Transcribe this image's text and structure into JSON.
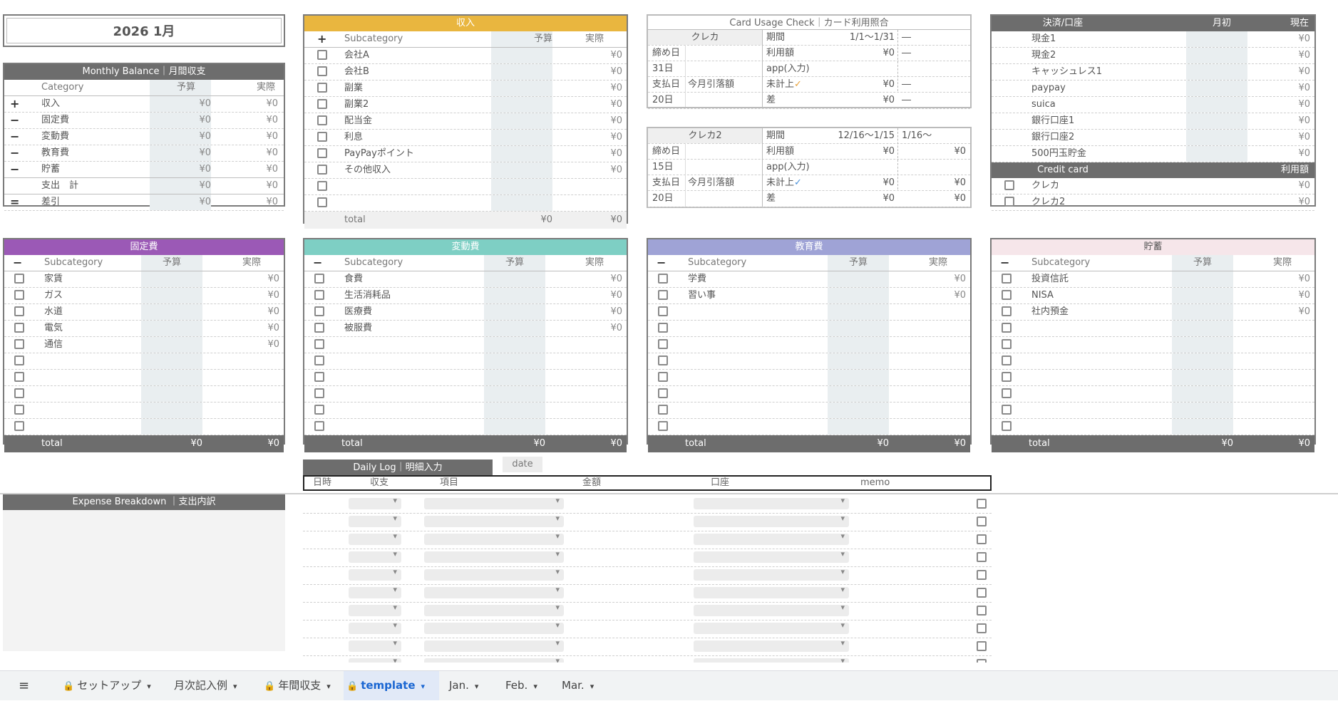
{
  "title": "2026  1月",
  "monthly": {
    "header": "Monthly Balance｜月間収支",
    "col_category": "Category",
    "col_budget": "予算",
    "col_actual": "実際",
    "rows": [
      {
        "sym": "+",
        "label": "収入",
        "budget": "¥0",
        "actual": "¥0"
      },
      {
        "sym": "−",
        "label": "固定費",
        "budget": "¥0",
        "actual": "¥0"
      },
      {
        "sym": "−",
        "label": "変動費",
        "budget": "¥0",
        "actual": "¥0"
      },
      {
        "sym": "−",
        "label": "教育費",
        "budget": "¥0",
        "actual": "¥0"
      },
      {
        "sym": "−",
        "label": "貯蓄",
        "budget": "¥0",
        "actual": "¥0"
      },
      {
        "sym": "",
        "label": "支出　計",
        "budget": "¥0",
        "actual": "¥0"
      },
      {
        "sym": "=",
        "label": "差引",
        "budget": "¥0",
        "actual": "¥0"
      }
    ]
  },
  "income": {
    "header": "収入",
    "color": "#e9b63f",
    "sym": "+",
    "col_sub": "Subcategory",
    "col_budget": "予算",
    "col_actual": "実際",
    "rows": [
      {
        "label": "会社A",
        "actual": "¥0"
      },
      {
        "label": "会社B",
        "actual": "¥0"
      },
      {
        "label": "副業",
        "actual": "¥0"
      },
      {
        "label": "副業2",
        "actual": "¥0"
      },
      {
        "label": "配当金",
        "actual": "¥0"
      },
      {
        "label": "利息",
        "actual": "¥0"
      },
      {
        "label": "PayPayポイント",
        "actual": "¥0"
      },
      {
        "label": "その他収入",
        "actual": "¥0"
      },
      {
        "label": "",
        "actual": ""
      },
      {
        "label": "",
        "actual": ""
      }
    ],
    "total_label": "total",
    "total_budget": "¥0",
    "total_actual": "¥0"
  },
  "card_check": {
    "header": "Card Usage Check｜カード利用照合",
    "cards": [
      {
        "name": "クレカ",
        "period_label": "期間",
        "period": "1/1〜1/31",
        "period_next": "―",
        "close_label": "締め日",
        "close_day": "31日",
        "usage_label": "利用額",
        "usage": "¥0",
        "usage_next": "―",
        "app_label": "app(入力)",
        "pay_label": "支払日",
        "debit_label": "今月引落額",
        "pay_day": "20日",
        "unposted_label": "未計上",
        "unposted": "¥0",
        "unposted_next": "―",
        "diff_label": "差",
        "diff": "¥0",
        "diff_next": "―",
        "check_color": "#e8a23a"
      },
      {
        "name": "クレカ2",
        "period_label": "期間",
        "period": "12/16〜1/15",
        "period_next": "1/16〜",
        "close_label": "締め日",
        "close_day": "15日",
        "usage_label": "利用額",
        "usage": "¥0",
        "usage_next": "¥0",
        "app_label": "app(入力)",
        "pay_label": "支払日",
        "debit_label": "今月引落額",
        "pay_day": "20日",
        "unposted_label": "未計上",
        "unposted": "¥0",
        "unposted_next": "¥0",
        "diff_label": "差",
        "diff": "¥0",
        "diff_next": "¥0",
        "check_color": "#4a90d9"
      }
    ],
    "check_mark": "✓"
  },
  "accounts": {
    "header": "決済/口座",
    "col_start": "月初",
    "col_now": "現在",
    "rows": [
      {
        "label": "現金1",
        "now": "¥0"
      },
      {
        "label": "現金2",
        "now": "¥0"
      },
      {
        "label": "キャッシュレス1",
        "now": "¥0"
      },
      {
        "label": "paypay",
        "now": "¥0"
      },
      {
        "label": "suica",
        "now": "¥0"
      },
      {
        "label": "銀行口座1",
        "now": "¥0"
      },
      {
        "label": "銀行口座2",
        "now": "¥0"
      },
      {
        "label": "500円玉貯金",
        "now": "¥0"
      }
    ],
    "credit_header": "Credit card",
    "credit_col": "利用額",
    "credit_rows": [
      {
        "label": "クレカ",
        "amount": "¥0"
      },
      {
        "label": "クレカ2",
        "amount": "¥0"
      }
    ]
  },
  "categories": [
    {
      "key": "fixed",
      "header": "固定費",
      "color": "#9b59b6",
      "sym": "−",
      "col_sub": "Subcategory",
      "col_budget": "予算",
      "col_actual": "実際",
      "rows": [
        {
          "label": "家賃",
          "actual": "¥0"
        },
        {
          "label": "ガス",
          "actual": "¥0"
        },
        {
          "label": "水道",
          "actual": "¥0"
        },
        {
          "label": "電気",
          "actual": "¥0"
        },
        {
          "label": "通信",
          "actual": "¥0"
        },
        {
          "label": "",
          "actual": ""
        },
        {
          "label": "",
          "actual": ""
        },
        {
          "label": "",
          "actual": ""
        },
        {
          "label": "",
          "actual": ""
        },
        {
          "label": "",
          "actual": ""
        }
      ],
      "total_label": "total",
      "total_budget": "¥0",
      "total_actual": "¥0"
    },
    {
      "key": "variable",
      "header": "変動費",
      "color": "#7ecfc4",
      "sym": "−",
      "col_sub": "Subcategory",
      "col_budget": "予算",
      "col_actual": "実際",
      "rows": [
        {
          "label": "食費",
          "actual": "¥0"
        },
        {
          "label": "生活消耗品",
          "actual": "¥0"
        },
        {
          "label": "医療費",
          "actual": "¥0"
        },
        {
          "label": "被服費",
          "actual": "¥0"
        },
        {
          "label": "",
          "actual": ""
        },
        {
          "label": "",
          "actual": ""
        },
        {
          "label": "",
          "actual": ""
        },
        {
          "label": "",
          "actual": ""
        },
        {
          "label": "",
          "actual": ""
        },
        {
          "label": "",
          "actual": ""
        }
      ],
      "total_label": "total",
      "total_budget": "¥0",
      "total_actual": "¥0"
    },
    {
      "key": "education",
      "header": "教育費",
      "color": "#9fa3d6",
      "sym": "−",
      "col_sub": "Subcategory",
      "col_budget": "予算",
      "col_actual": "実際",
      "rows": [
        {
          "label": "学費",
          "actual": "¥0"
        },
        {
          "label": "習い事",
          "actual": "¥0"
        },
        {
          "label": "",
          "actual": ""
        },
        {
          "label": "",
          "actual": ""
        },
        {
          "label": "",
          "actual": ""
        },
        {
          "label": "",
          "actual": ""
        },
        {
          "label": "",
          "actual": ""
        },
        {
          "label": "",
          "actual": ""
        },
        {
          "label": "",
          "actual": ""
        },
        {
          "label": "",
          "actual": ""
        }
      ],
      "total_label": "total",
      "total_budget": "¥0",
      "total_actual": "¥0"
    },
    {
      "key": "savings",
      "header": "貯蓄",
      "color": "#f6e6ea",
      "header_text": "#555",
      "sym": "−",
      "col_sub": "Subcategory",
      "col_budget": "予算",
      "col_actual": "実際",
      "rows": [
        {
          "label": "投資信託",
          "actual": "¥0"
        },
        {
          "label": "NISA",
          "actual": "¥0"
        },
        {
          "label": "社内預金",
          "actual": "¥0"
        },
        {
          "label": "",
          "actual": ""
        },
        {
          "label": "",
          "actual": ""
        },
        {
          "label": "",
          "actual": ""
        },
        {
          "label": "",
          "actual": ""
        },
        {
          "label": "",
          "actual": ""
        },
        {
          "label": "",
          "actual": ""
        },
        {
          "label": "",
          "actual": ""
        }
      ],
      "total_label": "total",
      "total_budget": "¥0",
      "total_actual": "¥0"
    }
  ],
  "daily_log": {
    "header": "Daily Log｜明細入力",
    "date_chip": "date",
    "cols": [
      "日時",
      "収支",
      "項目",
      "金額",
      "口座",
      "memo"
    ],
    "row_count": 10
  },
  "expense_breakdown": {
    "header": "Expense Breakdown ｜支出内訳"
  },
  "tabs": [
    {
      "label": "セットアップ",
      "locked": true,
      "active": false
    },
    {
      "label": "月次記入例",
      "locked": false,
      "active": false
    },
    {
      "label": "年間収支",
      "locked": true,
      "active": false
    },
    {
      "label": "template",
      "locked": true,
      "active": true
    },
    {
      "label": "Jan.",
      "locked": false,
      "active": false
    },
    {
      "label": "Feb.",
      "locked": false,
      "active": false
    },
    {
      "label": "Mar.",
      "locked": false,
      "active": false
    }
  ]
}
